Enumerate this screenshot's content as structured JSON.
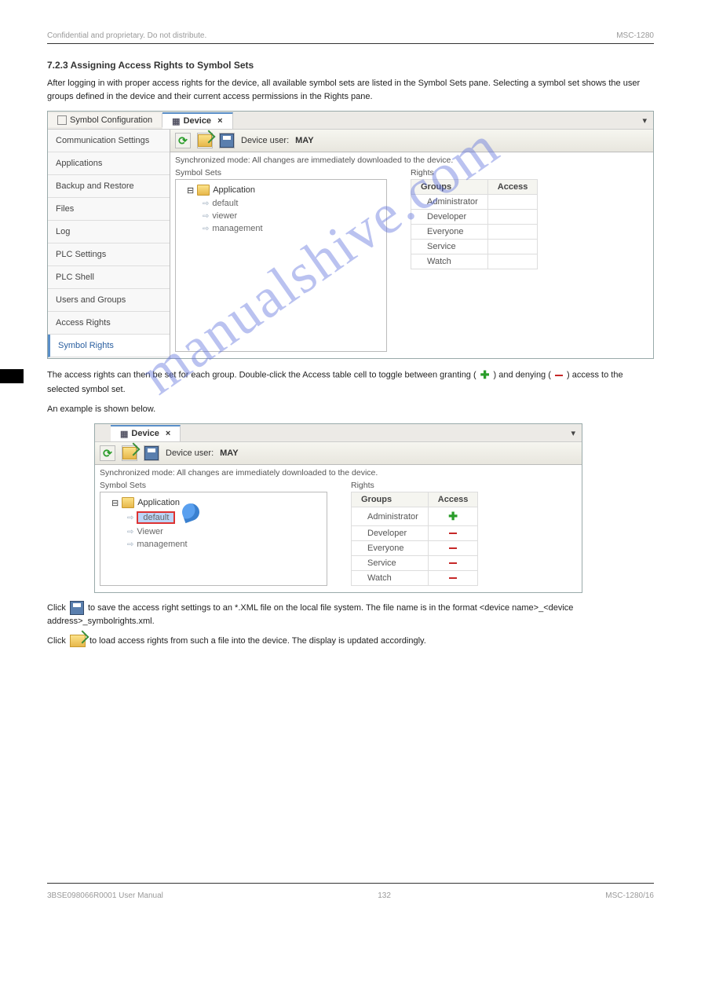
{
  "header": {
    "title_line": "Confidential and proprietary. Do not distribute.",
    "right_line": "MSC-1280"
  },
  "section_heading": "7.2.3   Assigning Access Rights to Symbol Sets",
  "intro_text": "After logging in with proper access rights for the device, all available symbol sets are listed in the Symbol Sets pane. Selecting a symbol set shows the user groups defined in the device and their current access permissions in the Rights pane.",
  "win1": {
    "tabs": {
      "symbol_config": "Symbol Configuration",
      "device": "Device"
    },
    "toolbar": {
      "device_user_label": "Device user:",
      "device_user_value": "MAY"
    },
    "status_line": "Synchronized mode: All changes are immediately downloaded to the device.",
    "sidebar": [
      "Communication Settings",
      "Applications",
      "Backup and Restore",
      "Files",
      "Log",
      "PLC Settings",
      "PLC Shell",
      "Users and Groups",
      "Access Rights",
      "Symbol Rights"
    ],
    "sections": {
      "left_title": "Symbol Sets",
      "right_title": "Rights"
    },
    "tree": {
      "root": "Application",
      "children": [
        "default",
        "viewer",
        "management"
      ]
    },
    "rights": {
      "cols": [
        "Groups",
        "Access"
      ],
      "rows": [
        "Administrator",
        "Developer",
        "Everyone",
        "Service",
        "Watch"
      ]
    }
  },
  "mid_text": {
    "line1_prefix": "The access rights can then be set for each group. Double-click the Access table cell to toggle between granting (",
    "line1_mid": ") and denying (",
    "line1_suffix": ") access to the selected symbol set.",
    "line2": "An example is shown below."
  },
  "win2": {
    "tab_device": "Device",
    "toolbar": {
      "device_user_label": "Device user:",
      "device_user_value": "MAY"
    },
    "status_line": "Synchronized mode: All changes are immediately downloaded to the device.",
    "sections": {
      "left_title": "Symbol Sets",
      "right_title": "Rights"
    },
    "tree": {
      "root": "Application",
      "children": [
        "default",
        "Viewer",
        "management"
      ]
    },
    "rights": {
      "cols": [
        "Groups",
        "Access"
      ],
      "rows": [
        {
          "name": "Administrator",
          "access": "plus"
        },
        {
          "name": "Developer",
          "access": "minus"
        },
        {
          "name": "Everyone",
          "access": "minus"
        },
        {
          "name": "Service",
          "access": "minus"
        },
        {
          "name": "Watch",
          "access": "minus"
        }
      ]
    }
  },
  "after_text": {
    "save_prefix": "Click ",
    "save_suffix": " to save the access right settings to an *.XML file on the local file system. The file name is in the format <device name>_<device address>_symbolrights.xml.",
    "open_prefix": "Click ",
    "open_suffix": " to load access rights from such a file into the device. The display is updated accordingly."
  },
  "footer": {
    "left": "3BSE098066R0001   User Manual",
    "page": "132",
    "right": "MSC-1280/16"
  },
  "watermark": "manualshive.com"
}
